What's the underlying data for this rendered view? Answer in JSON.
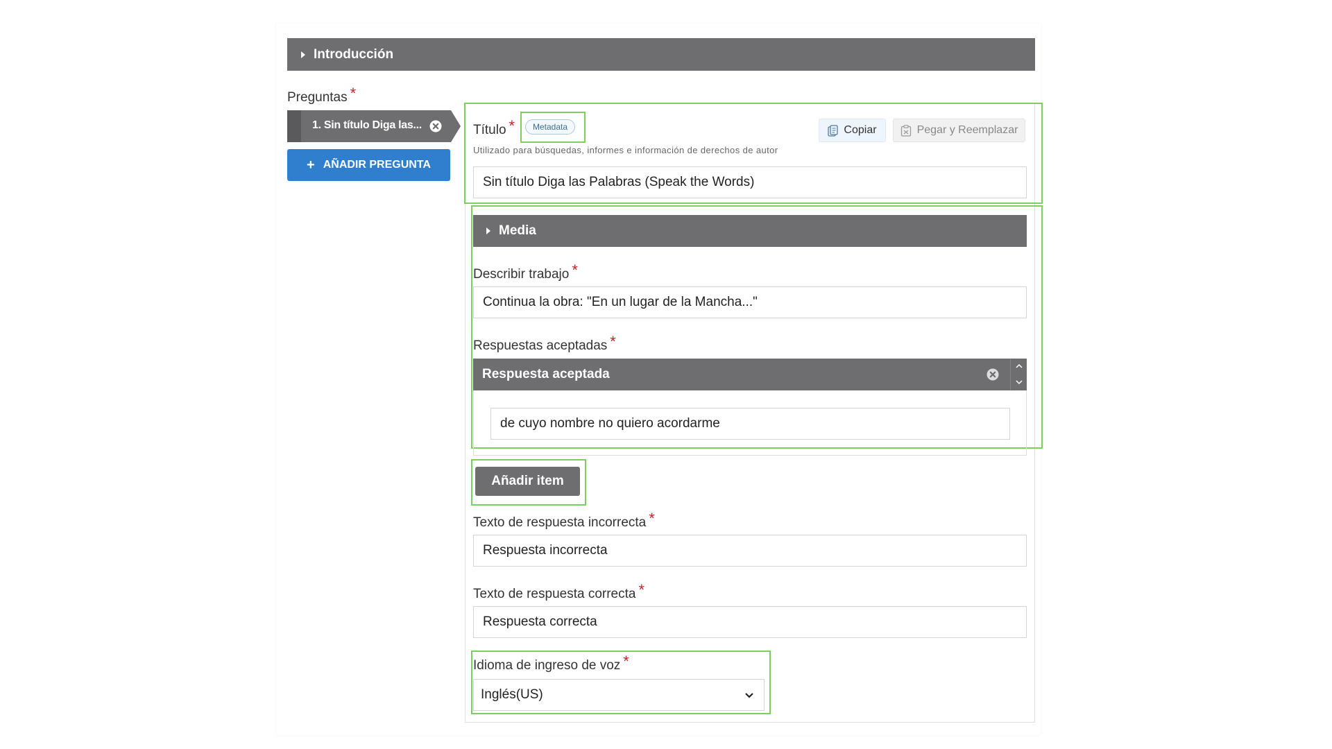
{
  "introduction": {
    "label": "Introducción"
  },
  "questions": {
    "label": "Preguntas",
    "required_mark": "*",
    "items": [
      {
        "label": "1. Sin título Diga las..."
      }
    ],
    "add_label": "AÑADIR PREGUNTA"
  },
  "title_field": {
    "label": "Título",
    "required_mark": "*",
    "metadata_label": "Metadata",
    "copy_label": "Copiar",
    "paste_label": "Pegar y Reemplazar",
    "help": "Utilizado para búsquedas, informes e información de derechos de autor",
    "value": "Sin título Diga las Palabras (Speak the Words)"
  },
  "media": {
    "label": "Media"
  },
  "describe": {
    "label": "Describir trabajo",
    "required_mark": "*",
    "value": "Continua la obra: \"En un lugar de la Mancha...\""
  },
  "accepted": {
    "label": "Respuestas aceptadas",
    "required_mark": "*",
    "item_title": "Respuesta aceptada",
    "item_value": "de cuyo nombre no quiero acordarme",
    "add_item_label": "Añadir item"
  },
  "incorrect": {
    "label": "Texto de respuesta incorrecta",
    "required_mark": "*",
    "value": "Respuesta incorrecta"
  },
  "correct": {
    "label": "Texto de respuesta correcta",
    "required_mark": "*",
    "value": "Respuesta correcta"
  },
  "voice_language": {
    "label": "Idioma de ingreso de voz",
    "required_mark": "*",
    "selected": "Inglés(US)"
  },
  "colors": {
    "dark_bar": "#6e6d70",
    "primary_button": "#2f7fce",
    "highlight": "#7ccf5f",
    "required": "#c0262c"
  }
}
